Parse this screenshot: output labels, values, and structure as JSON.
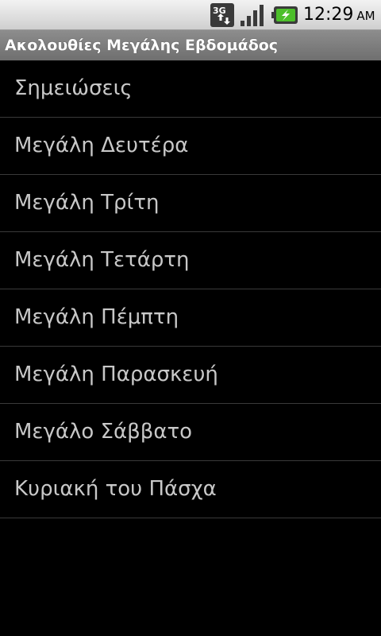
{
  "status_bar": {
    "network_label": "3G",
    "network_icon": "3g-data-icon",
    "signal_icon": "signal-strength-icon",
    "battery_icon": "battery-charging-icon",
    "time": "12:29",
    "ampm": "AM"
  },
  "title_bar": {
    "title": "Ακολουθίες Μεγάλης Εβδομάδος"
  },
  "list": {
    "items": [
      {
        "label": "Σημειώσεις"
      },
      {
        "label": "Μεγάλη Δευτέρα"
      },
      {
        "label": "Μεγάλη Τρίτη"
      },
      {
        "label": "Μεγάλη Τετάρτη"
      },
      {
        "label": "Μεγάλη Πέμπτη"
      },
      {
        "label": "Μεγάλη Παρασκευή"
      },
      {
        "label": "Μεγάλο Σάββατο"
      },
      {
        "label": "Κυριακή του Πάσχα"
      }
    ]
  },
  "colors": {
    "background": "#000000",
    "title_bar": "#7a7a7a",
    "status_bar": "#e0e0e0",
    "list_text": "#c8c8c8",
    "divider": "#3a3a3a",
    "battery_accent": "#4cbf2a"
  }
}
